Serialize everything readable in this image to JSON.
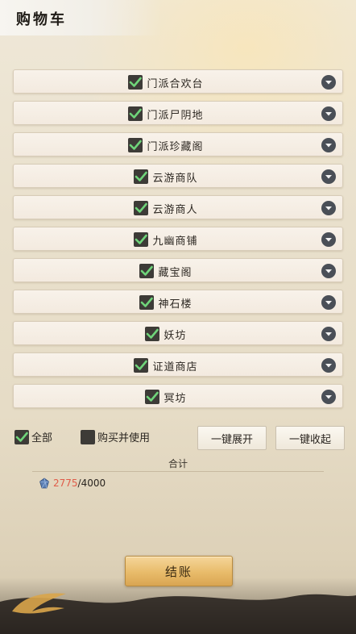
{
  "title": "购物车",
  "shops": [
    {
      "label": "门派合欢台",
      "checked": true
    },
    {
      "label": "门派尸阴地",
      "checked": true
    },
    {
      "label": "门派珍藏阁",
      "checked": true
    },
    {
      "label": "云游商队",
      "checked": true
    },
    {
      "label": "云游商人",
      "checked": true
    },
    {
      "label": "九幽商铺",
      "checked": true
    },
    {
      "label": "藏宝阁",
      "checked": true
    },
    {
      "label": "神石楼",
      "checked": true
    },
    {
      "label": "妖坊",
      "checked": true
    },
    {
      "label": "证道商店",
      "checked": true
    },
    {
      "label": "冥坊",
      "checked": true
    }
  ],
  "controls": {
    "select_all_label": "全部",
    "select_all_checked": true,
    "buy_and_use_label": "购买并使用",
    "buy_and_use_checked": false,
    "expand_all_label": "一键展开",
    "collapse_all_label": "一键收起"
  },
  "total": {
    "label": "合计",
    "current": "2775",
    "separator": "/",
    "max": "4000",
    "currency_icon": "blue-gem-icon"
  },
  "checkout_label": "结账",
  "colors": {
    "check": "#6fd47a",
    "over_amount": "#e05b48",
    "checkout_button": "#e8bb6a"
  }
}
